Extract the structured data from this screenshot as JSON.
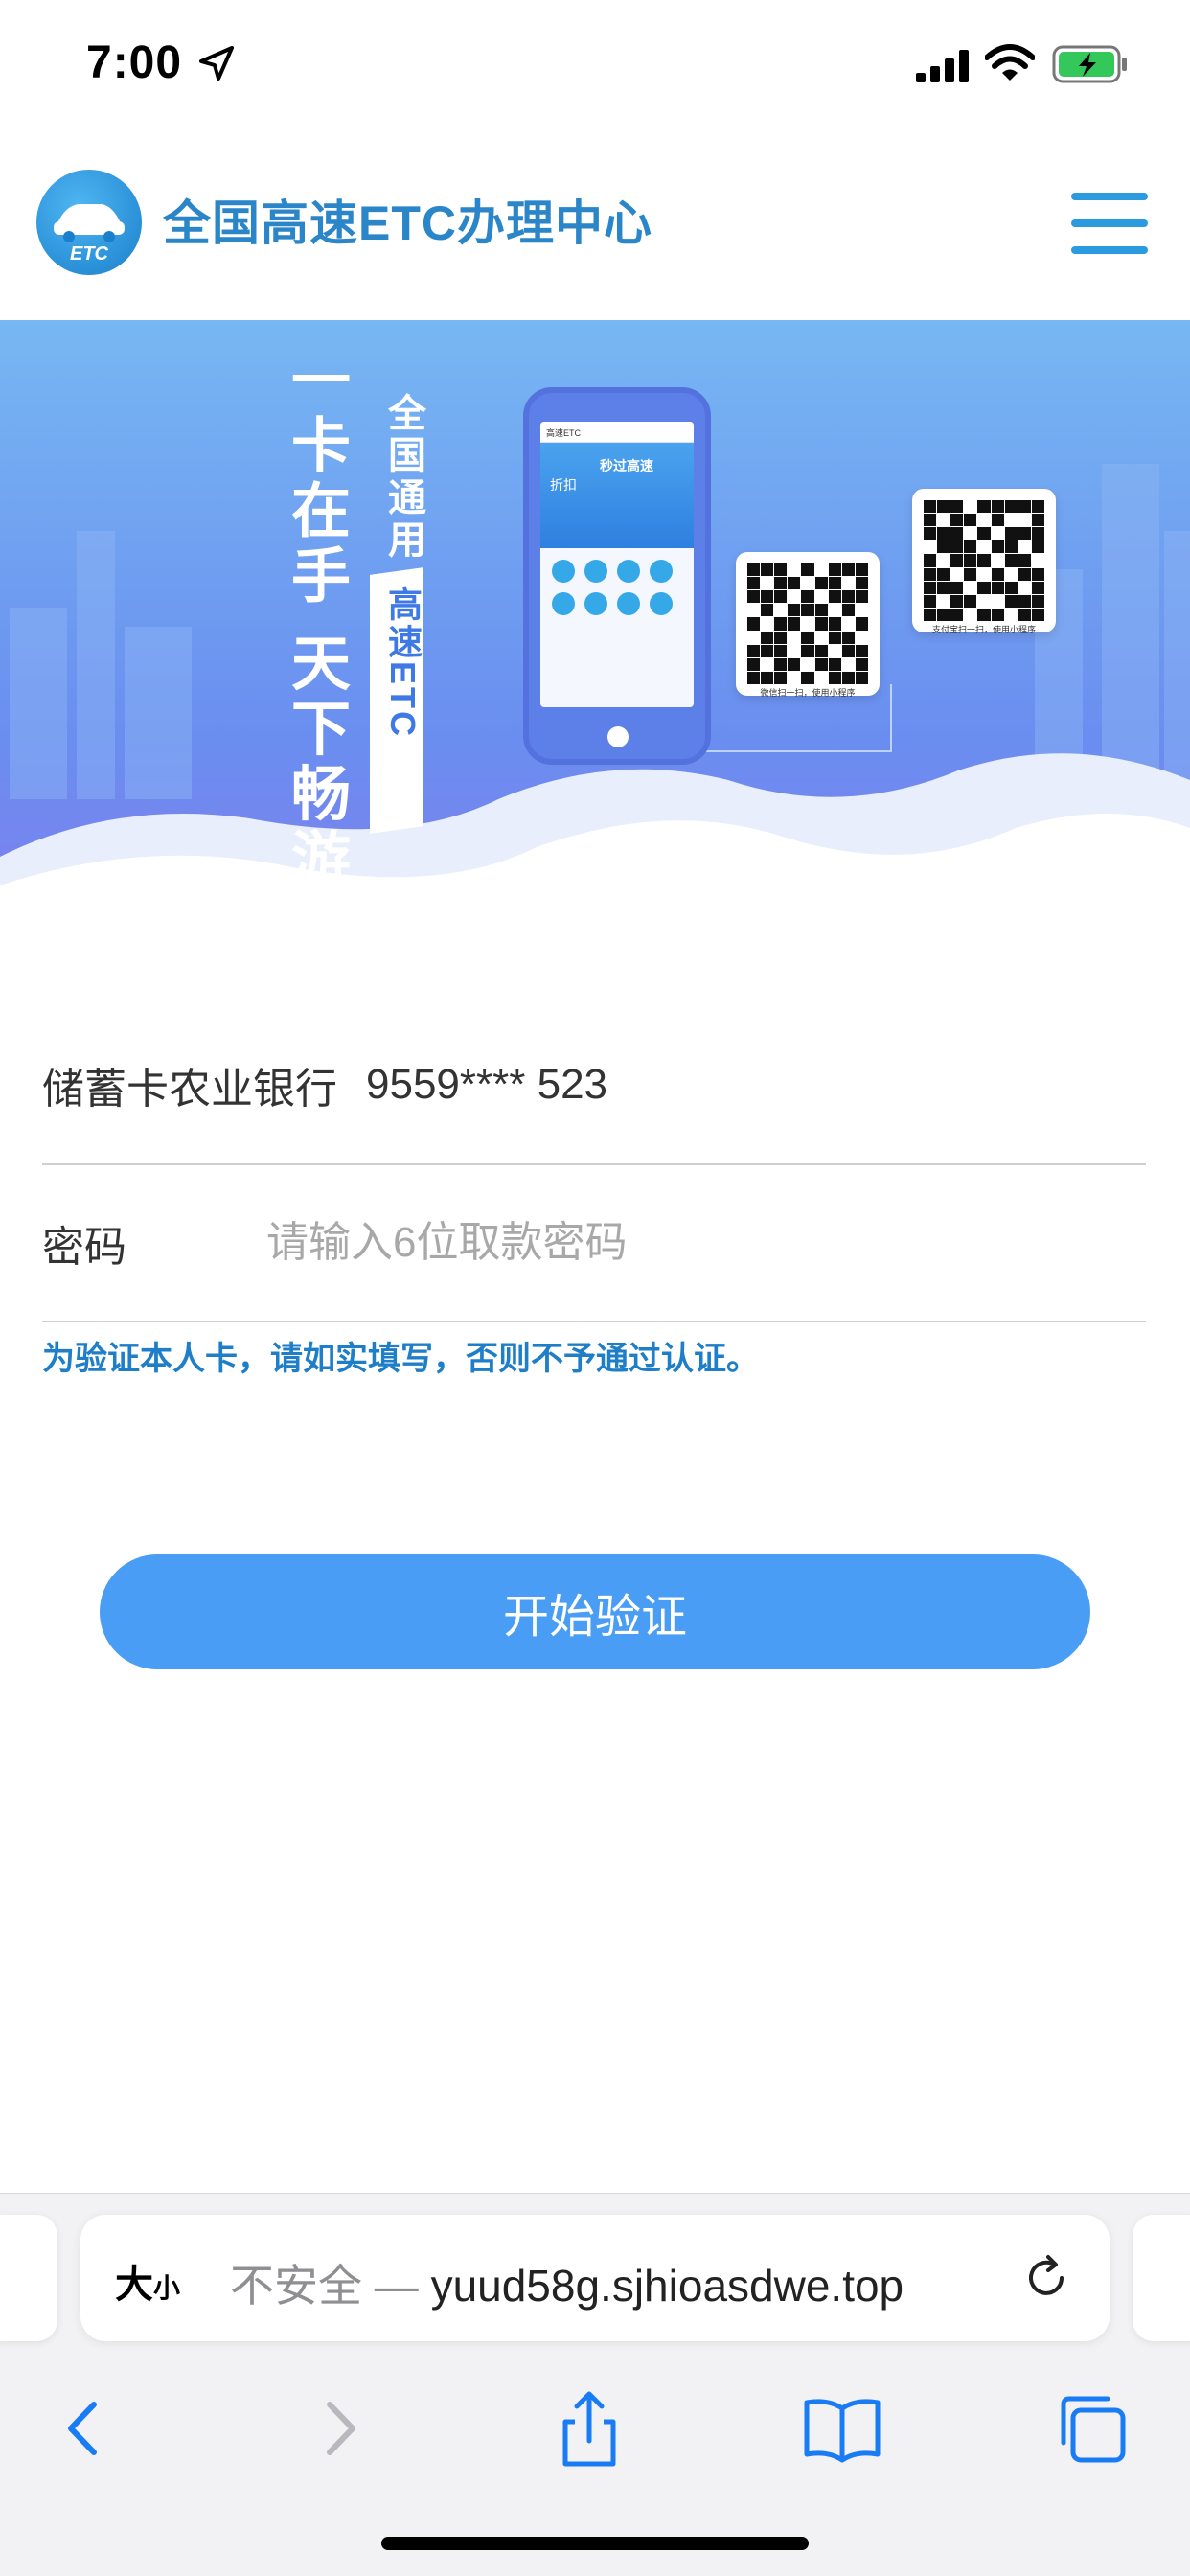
{
  "status_bar": {
    "time": "7:00"
  },
  "header": {
    "logo_badge": "ETC",
    "site_title": "全国高速ETC办理中心"
  },
  "banner": {
    "slogan_main": "一卡在手 天下畅游",
    "slogan_sub": "全国通用",
    "slogan_tag": "高速ETC",
    "phone_app_title": "高速ETC",
    "phone_banner_text": "秒过高速",
    "phone_banner_sub": "折扣",
    "qr1_caption": "微信扫一扫，使用小程序",
    "qr2_caption": "支付宝扫一扫，使用小程序"
  },
  "form": {
    "card_label": "储蓄卡农业银行",
    "card_number": "9559**** 523",
    "password_label": "密码",
    "password_placeholder": "请输入6位取款密码",
    "hint": "为验证本人卡，请如实填写，否则不予通过认证。",
    "submit_label": "开始验证"
  },
  "browser": {
    "text_size_label": "大",
    "text_size_small": "小",
    "security_label": "不安全 — ",
    "host": "yuud58g.sjhioasdwe.top"
  },
  "icons": {
    "location": "location-arrow-icon",
    "signal": "cellular-signal-icon",
    "wifi": "wifi-icon",
    "battery": "battery-charging-icon",
    "menu": "hamburger-menu-icon",
    "reload": "reload-icon",
    "back": "chevron-left-icon",
    "forward": "chevron-right-icon",
    "share": "share-icon",
    "bookmarks": "book-icon",
    "tabs": "tabs-icon"
  },
  "colors": {
    "accent": "#4a9df4",
    "brand_text": "#2b86c9",
    "hint_text": "#1e7ec8",
    "battery_fill": "#34c759"
  }
}
